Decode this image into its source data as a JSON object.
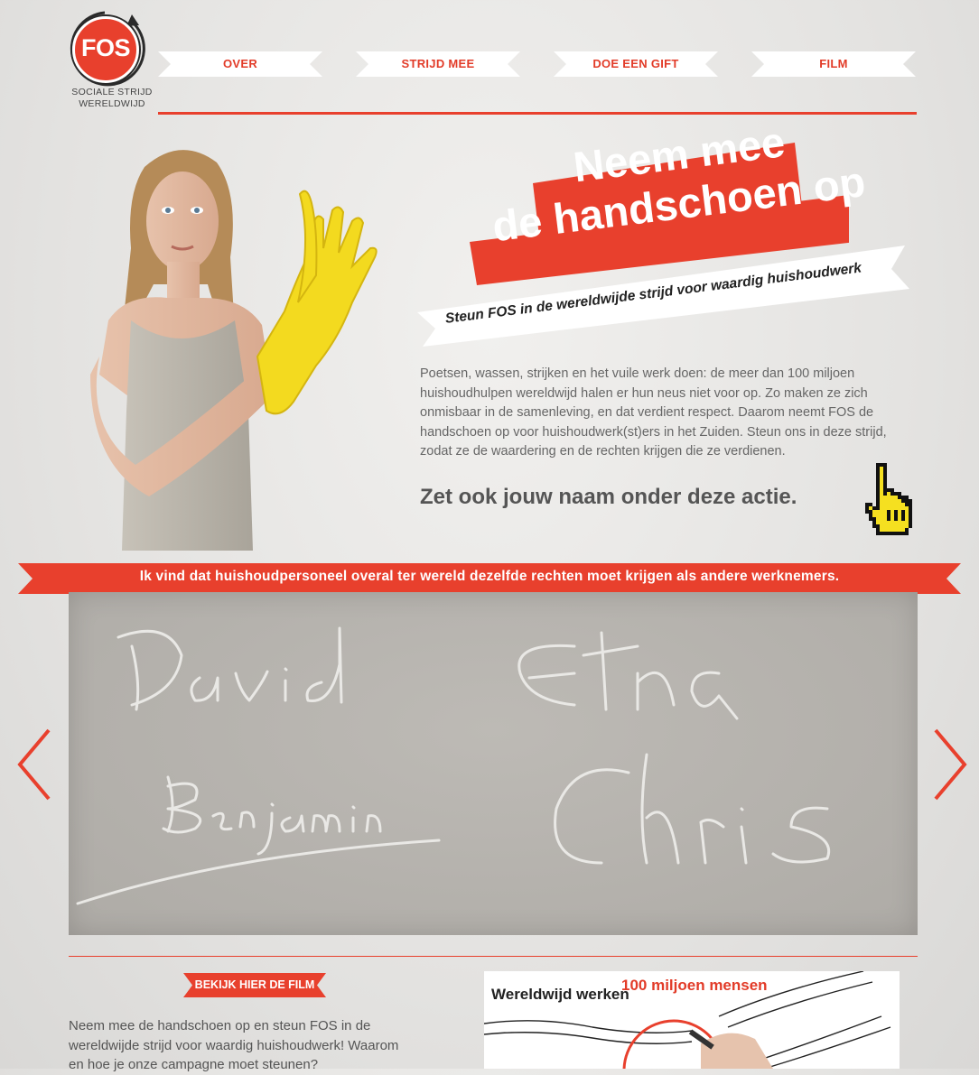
{
  "logo": {
    "text": "FOS",
    "tagline_1": "SOCIALE STRIJD",
    "tagline_2": "WERELDWIJD"
  },
  "nav": [
    {
      "label": "OVER"
    },
    {
      "label": "STRIJD MEE"
    },
    {
      "label": "DOE EEN GIFT"
    },
    {
      "label": "FILM"
    }
  ],
  "hero": {
    "headline_line1": "Neem mee",
    "headline_line2": "de handschoen op",
    "subheadline": "Steun FOS in de wereldwijde strijd voor waardig huishoudwerk",
    "intro": "Poetsen, wassen, strijken en het vuile werk doen: de meer dan 100 miljoen huishoudhulpen wereldwijd halen er hun neus niet voor op. Zo maken ze zich onmisbaar in de samenleving, en dat verdient respect. Daarom neemt FOS de handschoen op voor huishoudwerk(st)ers in het Zuiden. Steun ons in deze strijd, zodat ze de waardering en de rechten krijgen die ze verdienen.",
    "cta": "Zet ook jouw naam onder deze actie."
  },
  "ribbon": {
    "text": "Ik vind dat huishoudpersoneel overal ter wereld dezelfde rechten moet krijgen als andere werknemers."
  },
  "signatures": [
    "David",
    "Etna",
    "Benjamin",
    "Chris"
  ],
  "film": {
    "button_label": "BEKIJK HIER DE FILM",
    "text": "Neem mee de handschoen op en steun FOS in de wereldwijde strijd voor waardig huishoudwerk! Waarom en hoe je onze campagne moet steunen?",
    "thumb_title": "Wereldwijd werken",
    "thumb_highlight": "100 miljoen mensen"
  },
  "colors": {
    "accent": "#e8402d",
    "background": "#e6e5e3"
  }
}
